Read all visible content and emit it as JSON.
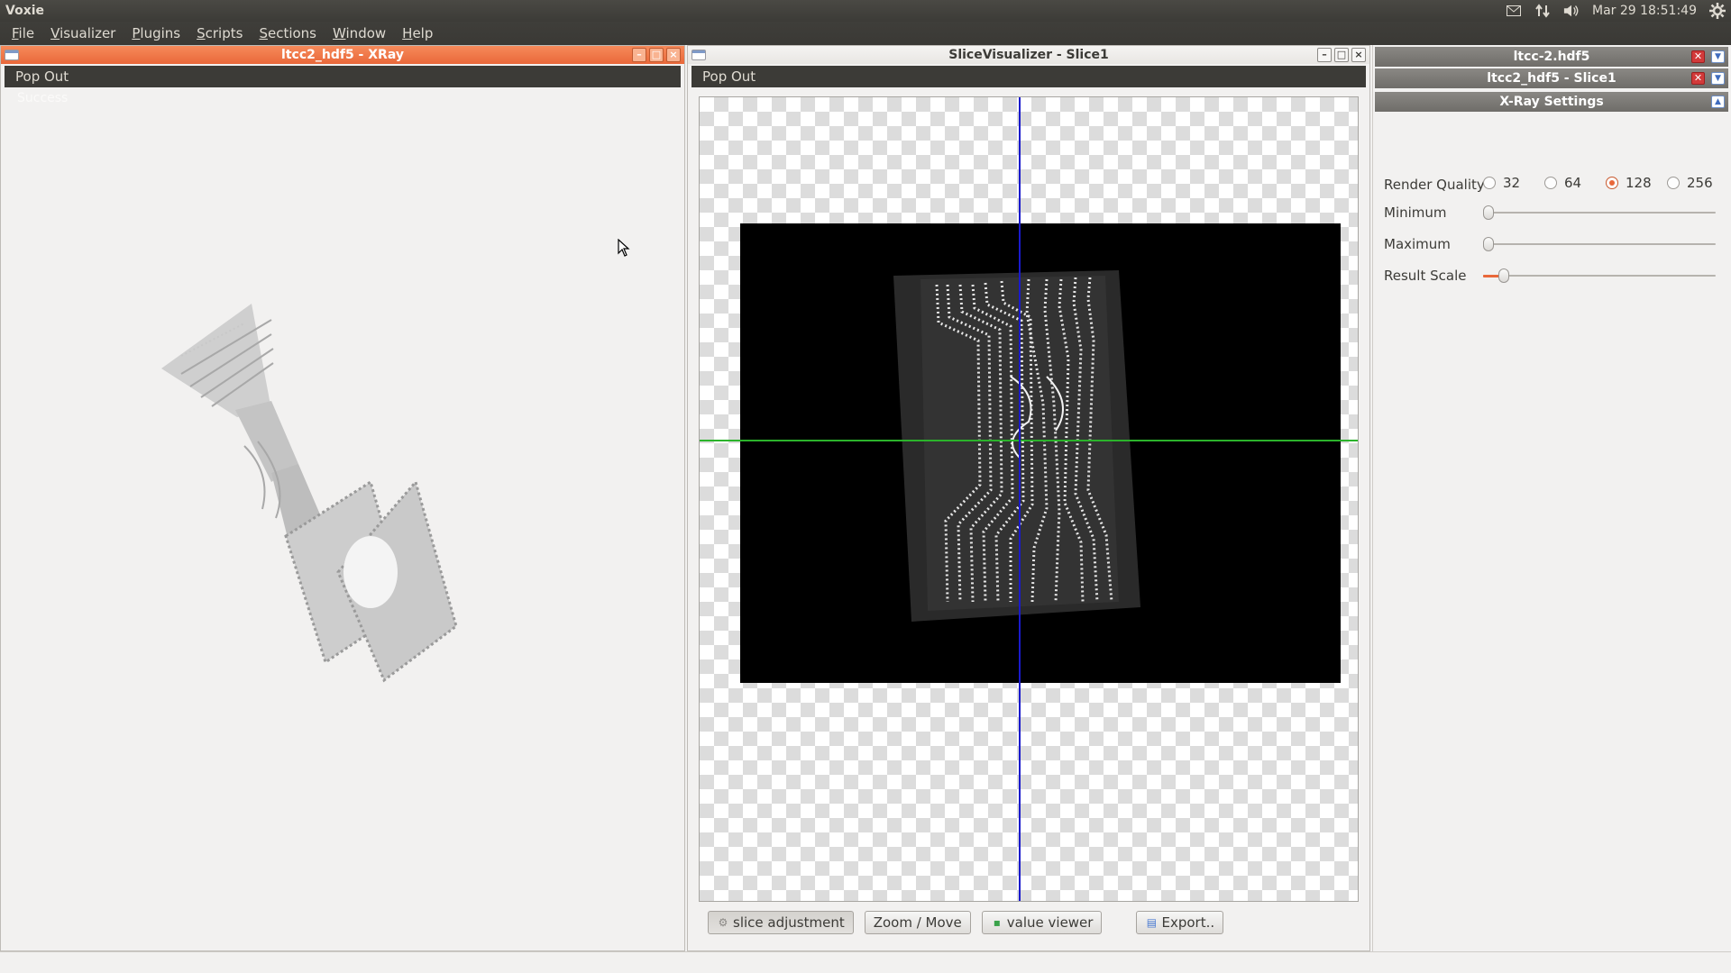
{
  "panel": {
    "app_name": "Voxie",
    "datetime": "Mar 29 18:51:49",
    "icons": [
      "mail-icon",
      "network-icon",
      "volume-icon",
      "settings-gear-icon"
    ]
  },
  "menu": {
    "items": [
      {
        "first": "F",
        "rest": "ile"
      },
      {
        "first": "V",
        "rest": "isualizer"
      },
      {
        "first": "P",
        "rest": "lugins"
      },
      {
        "first": "S",
        "rest": "cripts"
      },
      {
        "first": "S",
        "rest": "ections"
      },
      {
        "first": "W",
        "rest": "indow"
      },
      {
        "first": "H",
        "rest": "elp"
      }
    ]
  },
  "xray_window": {
    "title": "ltcc2_hdf5 - XRay",
    "popout_label": "Pop Out",
    "status_text": "Success"
  },
  "slice_window": {
    "title": "SliceVisualizer - Slice1",
    "popout_label": "Pop Out",
    "buttons": {
      "slice_adjustment": "slice adjustment",
      "zoom_move": "Zoom / Move",
      "value_viewer": "value viewer",
      "export": "Export.."
    }
  },
  "side_panel": {
    "sections": {
      "dataset": "ltcc-2.hdf5",
      "slice": "ltcc2_hdf5 - Slice1",
      "xray_settings": "X-Ray Settings"
    },
    "render_quality_label": "Render Quality",
    "render_quality_options": [
      "32",
      "64",
      "128",
      "256"
    ],
    "render_quality_selected": "128",
    "minimum_label": "Minimum",
    "maximum_label": "Maximum",
    "result_scale_label": "Result Scale",
    "minimum_level": 0.0,
    "maximum_level": 0.0,
    "result_scale_level": 0.07
  },
  "colors": {
    "accent": "#e9683a",
    "panel_dark": "#3c3b37",
    "crosshair_horizontal": "#2bb32b",
    "crosshair_vertical": "#1a1acc"
  }
}
